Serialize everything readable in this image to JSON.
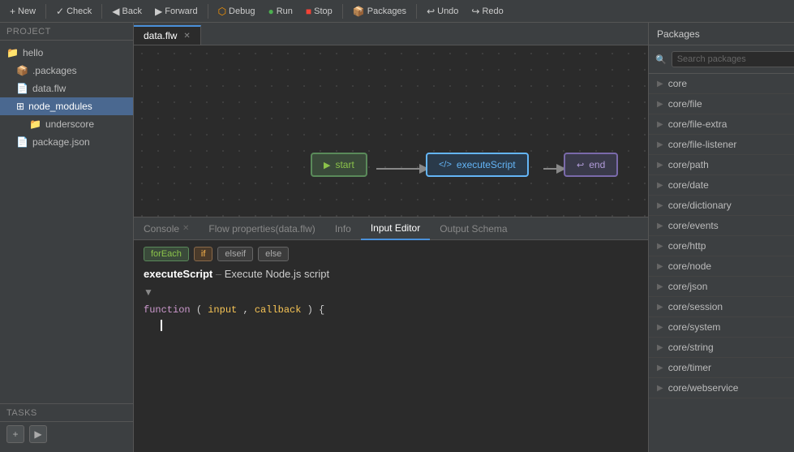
{
  "toolbar": {
    "new_label": "New",
    "check_label": "Check",
    "back_label": "Back",
    "forward_label": "Forward",
    "debug_label": "Debug",
    "run_label": "Run",
    "stop_label": "Stop",
    "packages_label": "Packages",
    "undo_label": "Undo",
    "redo_label": "Redo"
  },
  "sidebar": {
    "header": "Project",
    "items": [
      {
        "label": "hello",
        "icon": "📁",
        "indent": 0
      },
      {
        "label": ".packages",
        "icon": "📦",
        "indent": 1
      },
      {
        "label": "data.flw",
        "icon": "📄",
        "indent": 1
      },
      {
        "label": "node_modules",
        "icon": "⊞",
        "indent": 1,
        "selected": true
      },
      {
        "label": "underscore",
        "icon": "📁",
        "indent": 2
      },
      {
        "label": "package.json",
        "icon": "📄",
        "indent": 1
      }
    ],
    "tasks_header": "Tasks"
  },
  "file_tab": {
    "name": "data.flw"
  },
  "flow": {
    "nodes": [
      {
        "id": "start",
        "label": "start",
        "type": "start"
      },
      {
        "id": "executeScript",
        "label": "executeScript",
        "type": "execute"
      },
      {
        "id": "end",
        "label": "end",
        "type": "end"
      }
    ]
  },
  "bottom_panel": {
    "tabs": [
      {
        "label": "Console",
        "active": false
      },
      {
        "label": "Flow properties(data.flw)",
        "active": false
      },
      {
        "label": "Info",
        "active": false
      },
      {
        "label": "Input Editor",
        "active": true
      },
      {
        "label": "Output Schema",
        "active": false
      }
    ],
    "tags": [
      {
        "label": "forEach",
        "type": "for-each"
      },
      {
        "label": "if",
        "type": "if"
      },
      {
        "label": "elseif",
        "type": "else-if"
      },
      {
        "label": "else",
        "type": "else"
      }
    ],
    "node_title": "executeScript",
    "node_desc": "Execute Node.js script",
    "code": "function (input, callback) {"
  },
  "packages": {
    "header": "Packages",
    "search_placeholder": "Search packages",
    "items": [
      {
        "name": "core"
      },
      {
        "name": "core/file"
      },
      {
        "name": "core/file-extra"
      },
      {
        "name": "core/file-listener"
      },
      {
        "name": "core/path"
      },
      {
        "name": "core/date"
      },
      {
        "name": "core/dictionary"
      },
      {
        "name": "core/events"
      },
      {
        "name": "core/http"
      },
      {
        "name": "core/node"
      },
      {
        "name": "core/json"
      },
      {
        "name": "core/session"
      },
      {
        "name": "core/system"
      },
      {
        "name": "core/string"
      },
      {
        "name": "core/timer"
      },
      {
        "name": "core/webservice"
      }
    ]
  }
}
